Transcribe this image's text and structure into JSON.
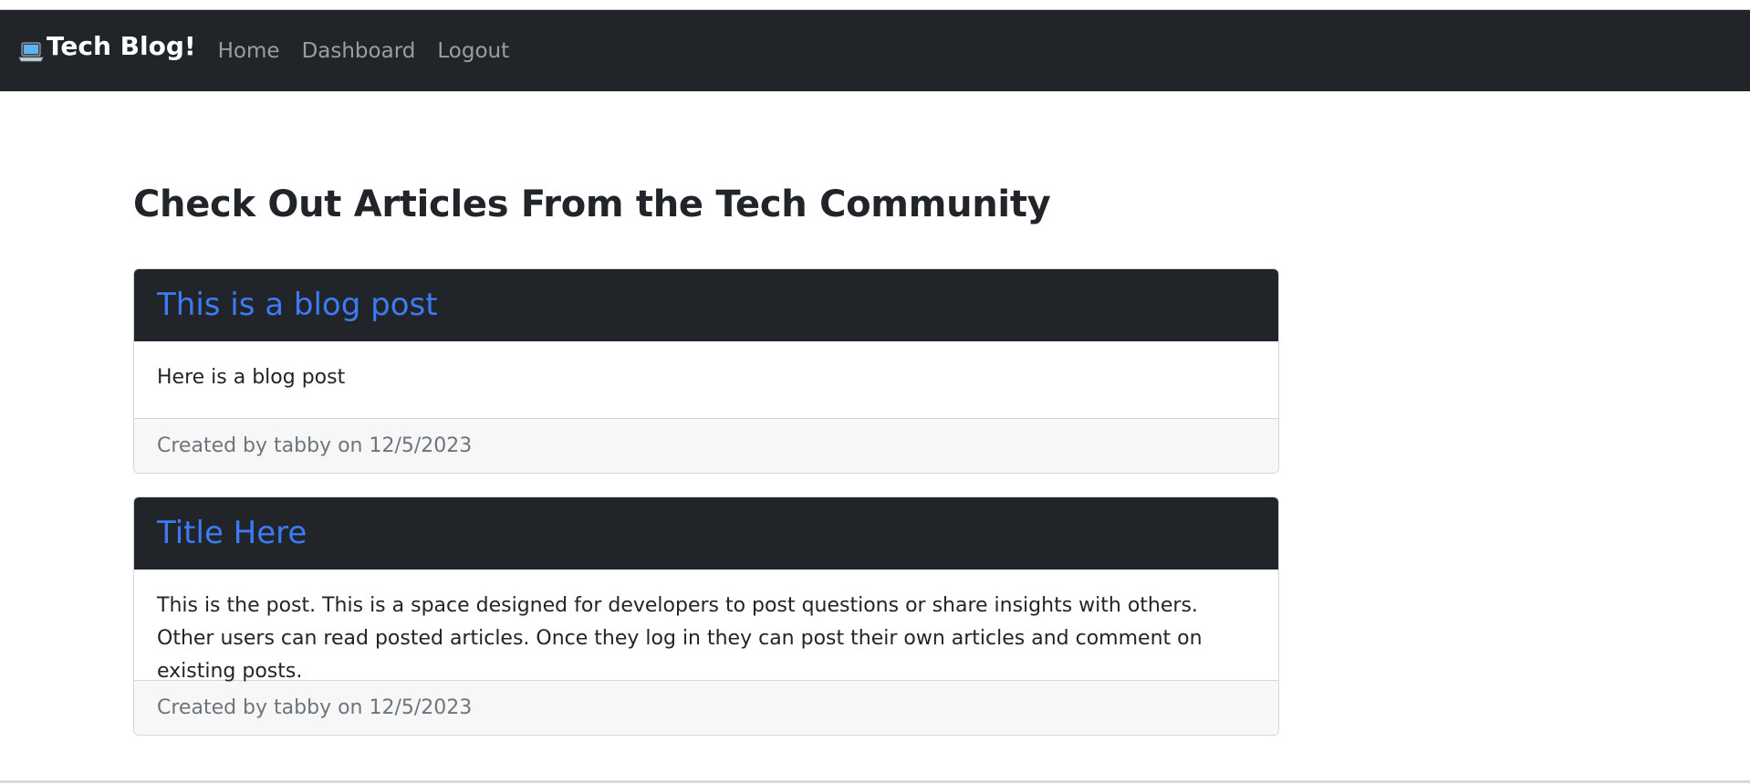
{
  "navbar": {
    "brand_icon": "laptop-icon",
    "brand": "Tech Blog!",
    "links": [
      {
        "label": "Home"
      },
      {
        "label": "Dashboard"
      },
      {
        "label": "Logout"
      }
    ]
  },
  "main": {
    "heading": "Check Out Articles From the Tech Community",
    "posts": [
      {
        "title": "This is a blog post",
        "body": "Here is a blog post",
        "footer": "Created by tabby on 12/5/2023"
      },
      {
        "title": "Title Here",
        "body": "This is the post. This is a space designed for developers to post questions or share insights with others. Other users can read posted articles. Once they log in they can post their own articles and comment on existing posts.",
        "footer": "Created by tabby on 12/5/2023"
      }
    ]
  },
  "colors": {
    "navbar_bg": "#212529",
    "link_blue": "#3d7bf5",
    "footer_bg": "#f7f7f7"
  }
}
